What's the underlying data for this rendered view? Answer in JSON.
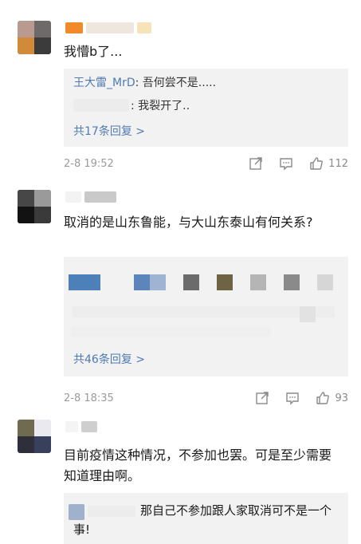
{
  "comments": [
    {
      "text": "我懵b了...",
      "replies": [
        {
          "name": "王大雷_MrD",
          "sep": ": ",
          "text": "吾何尝不是....."
        },
        {
          "name": "",
          "sep": ": ",
          "text": "我裂开了.."
        }
      ],
      "more": "共17条回复 >",
      "time": "2-8 19:52",
      "likes": "112"
    },
    {
      "text": "取消的是山东鲁能，与大山东泰山有何关系?",
      "replies": [],
      "more": "共46条回复 >",
      "time": "2-8 18:35",
      "likes": "93"
    },
    {
      "text": "目前疫情这种情况，不参加也罢。可是至少需要知道理由啊。",
      "replies": [
        {
          "name": "",
          "sep": "",
          "text": "那自己不参加跟人家取消可不是一个事!"
        }
      ]
    }
  ],
  "icons": [
    "share-icon",
    "comment-icon",
    "like-icon"
  ],
  "colors": {
    "link": "#4f7bb3",
    "reply_bg": "#f2f2f2",
    "meta": "#9a9a9a"
  }
}
